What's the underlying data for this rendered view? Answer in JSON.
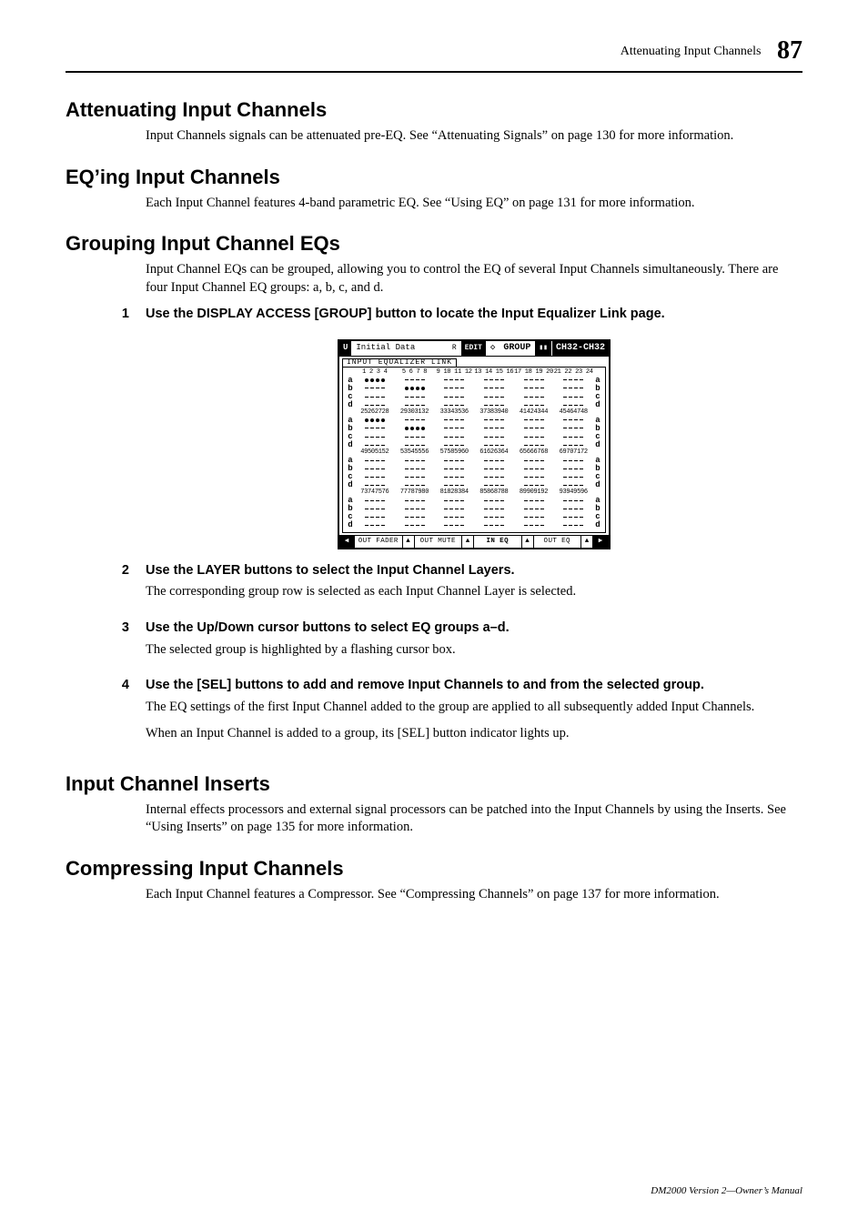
{
  "runningHeader": {
    "title": "Attenuating Input Channels",
    "pageNum": "87"
  },
  "sections": {
    "s1": {
      "heading": "Attenuating Input Channels",
      "body": "Input Channels signals can be attenuated pre-EQ. See “Attenuating Signals” on page 130 for more information."
    },
    "s2": {
      "heading": "EQ’ing Input Channels",
      "body": "Each Input Channel features 4-band parametric EQ. See “Using EQ” on page 131 for more information."
    },
    "s3": {
      "heading": "Grouping Input Channel EQs",
      "intro": "Input Channel EQs can be grouped, allowing you to control the EQ of several Input Channels simultaneously. There are four Input Channel EQ groups: a, b, c, and d.",
      "steps": {
        "1": {
          "num": "1",
          "title": "Use the DISPLAY ACCESS [GROUP] button to locate the Input Equalizer Link page."
        },
        "2": {
          "num": "2",
          "title": "Use the LAYER buttons to select the Input Channel Layers.",
          "body": "The corresponding group row is selected as each Input Channel Layer is selected."
        },
        "3": {
          "num": "3",
          "title": "Use the Up/Down cursor buttons to select EQ groups a–d.",
          "body": "The selected group is highlighted by a flashing cursor box."
        },
        "4": {
          "num": "4",
          "title": "Use the [SEL] buttons to add and remove Input Channels to and from the selected group.",
          "body1": "The EQ settings of the first Input Channel added to the group are applied to all subsequently added Input Channels.",
          "body2": "When an Input Channel is added to a group, its [SEL] button indicator lights up."
        }
      }
    },
    "s4": {
      "heading": "Input Channel Inserts",
      "body": "Internal effects processors and external signal processors can be patched into the Input Channels by using the Inserts. See “Using Inserts” on page 135 for more information."
    },
    "s5": {
      "heading": "Compressing Input Channels",
      "body": "Each Input Channel features a Compressor. See “Compressing Channels” on page 137 for more information."
    }
  },
  "lcd": {
    "topbar": {
      "u": "U",
      "initial": "Initial Data",
      "r": "R",
      "edit": "EDIT",
      "diamond": "◇",
      "group": "GROUP",
      "ch": "CH32-CH32"
    },
    "tabLabel": "INPUT EQUALIZER LINK",
    "chHeaders": [
      [
        "1 2 3 4",
        "5 6 7 8",
        "9 10 11 12",
        "13 14 15 16",
        "17 18 19 20",
        "21 22 23 24"
      ],
      [
        "25262728",
        "29303132",
        "33343536",
        "37383940",
        "41424344",
        "45464748"
      ],
      [
        "49505152",
        "53545556",
        "57585960",
        "61626364",
        "65666768",
        "69707172"
      ],
      [
        "73747576",
        "77787980",
        "81828384",
        "85868788",
        "89909192",
        "93949596"
      ]
    ],
    "groupLabels": [
      "a",
      "b",
      "c",
      "d"
    ],
    "bottomTabs": {
      "left": "◀",
      "t1": "OUT FADER",
      "t2": "OUT MUTE",
      "t3": "IN EQ",
      "t4": "OUT EQ",
      "right": "▶"
    }
  },
  "footer": "DM2000 Version 2—Owner’s Manual"
}
